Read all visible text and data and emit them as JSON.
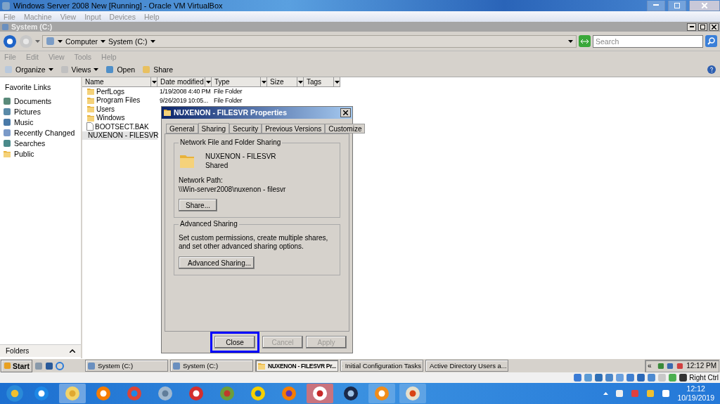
{
  "host_window": {
    "title": "Windows Server 2008 New [Running] - Oracle VM VirtualBox",
    "menu": [
      "File",
      "Machine",
      "View",
      "Input",
      "Devices",
      "Help"
    ]
  },
  "explorer": {
    "title": "System (C:)",
    "breadcrumb": [
      "Computer",
      "System (C:)"
    ],
    "search": {
      "placeholder": "Search"
    },
    "menu": [
      "File",
      "Edit",
      "View",
      "Tools",
      "Help"
    ],
    "toolbar": [
      {
        "label": "Organize",
        "kind": "menu"
      },
      {
        "label": "Views",
        "kind": "menu"
      },
      {
        "label": "Open",
        "kind": "button"
      },
      {
        "label": "Share",
        "kind": "button"
      }
    ],
    "favorite_links": {
      "title": "Favorite Links",
      "items": [
        "Documents",
        "Pictures",
        "Music",
        "Recently Changed",
        "Searches",
        "Public"
      ]
    },
    "folders_label": "Folders",
    "columns": [
      "Name",
      "Date modified",
      "Type",
      "Size",
      "Tags"
    ],
    "rows": [
      {
        "name": "PerfLogs",
        "date": "1/19/2008 4:40 PM",
        "type": "File Folder",
        "kind": "folder",
        "selected": false
      },
      {
        "name": "Program Files",
        "date": "9/26/2019 10:05...",
        "type": "File Folder",
        "kind": "folder",
        "selected": false
      },
      {
        "name": "Users",
        "kind": "folder",
        "selected": false
      },
      {
        "name": "Windows",
        "kind": "folder",
        "selected": false
      },
      {
        "name": "BOOTSECT.BAK",
        "kind": "file",
        "selected": false
      },
      {
        "name": "NUXENON - FILESVR",
        "kind": "share",
        "selected": true
      }
    ]
  },
  "dialog": {
    "title": "NUXENON - FILESVR Properties",
    "tabs": [
      {
        "label": "General",
        "selected": false
      },
      {
        "label": "Sharing",
        "selected": true
      },
      {
        "label": "Security",
        "selected": false
      },
      {
        "label": "Previous Versions",
        "selected": false
      },
      {
        "label": "Customize",
        "selected": false
      }
    ],
    "network_sharing": {
      "title": "Network File and Folder Sharing",
      "name": "NUXENON - FILESVR",
      "status": "Shared",
      "path_label": "Network Path:",
      "path": "\\\\Win-server2008\\nuxenon - filesvr",
      "button": "Share..."
    },
    "advanced_sharing": {
      "title": "Advanced Sharing",
      "description": "Set custom permissions, create multiple shares, and set other advanced sharing options.",
      "button": "Advanced Sharing..."
    },
    "buttons": [
      {
        "label": "Close",
        "disabled": false,
        "highlighted": true
      },
      {
        "label": "Cancel",
        "disabled": true,
        "highlighted": false
      },
      {
        "label": "Apply",
        "disabled": true,
        "highlighted": false
      }
    ]
  },
  "guest_taskbar": {
    "start": "Start",
    "buttons": [
      {
        "label": "System (C:)",
        "selected": false
      },
      {
        "label": "System (C:)",
        "selected": false
      },
      {
        "label": "NUXENON - FILESVR Pr...",
        "selected": true
      },
      {
        "label": "Initial Configuration Tasks",
        "selected": false
      },
      {
        "label": "Active Directory Users a...",
        "selected": false
      }
    ],
    "tray_toggle": "«",
    "clock": "12:12 PM"
  },
  "vbox_status": {
    "host_key": "Right Ctrl"
  },
  "host_taskbar": {
    "time": "12:12",
    "date": "10/19/2019"
  }
}
